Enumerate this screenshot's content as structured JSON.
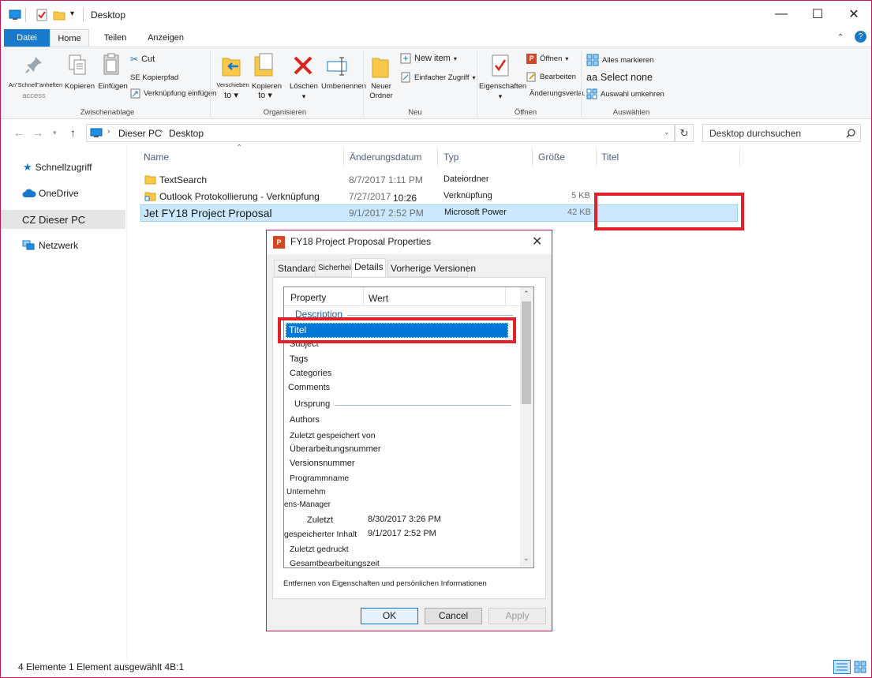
{
  "window": {
    "title": "Desktop"
  },
  "ribbon_tabs": {
    "datei": "Datei",
    "start": "Home",
    "teilen": "Teilen",
    "anzeigen": "Anzeigen"
  },
  "ribbon": {
    "clipboard": {
      "pin_label": "An\"Schnell\"anheften",
      "pin_sub": "access",
      "copy": "Kopieren",
      "paste": "Einfügen",
      "cut": "Cut",
      "copy_path": "SE Kopierpfad",
      "paste_shortcut": "Verknüpfung einfügen",
      "group": "Zwischenablage"
    },
    "organize": {
      "move": "Verschieben",
      "move_to": "to",
      "copy": "Kopieren",
      "copy_to": "to",
      "delete": "Löschen",
      "rename": "Umbenennen",
      "group": "Organisieren"
    },
    "new": {
      "new_folder_1": "Neuer",
      "new_folder_2": "Ordner",
      "new_item": "New item",
      "easy_access": "Einfacher Zugriff",
      "group": "Neu"
    },
    "open": {
      "properties": "Eigenschaften",
      "open": "Öffnen",
      "edit": "Bearbeiten",
      "history": "Änderungsverlauf",
      "group": "Öffnen"
    },
    "select": {
      "select_all": "Alles markieren",
      "select_none_prefix": "aa",
      "select_none": "Select none",
      "invert": "Auswahl umkehren",
      "group": "Auswählen"
    }
  },
  "address": {
    "path_1": "Dieser PC",
    "path_2": "Desktop",
    "search_placeholder": "Desktop durchsuchen"
  },
  "nav": {
    "quick": "Schnellzugriff",
    "onedrive": "OneDrive",
    "thispc": "CZ Dieser PC",
    "network": "Netzwerk"
  },
  "columns": {
    "name": "Name",
    "date": "Änderungsdatum",
    "type": "Typ",
    "size": "Größe",
    "title": "Titel"
  },
  "files": [
    {
      "name": "TextSearch",
      "date": "8/7/2017 1:11 PM",
      "type": "Dateiordner",
      "size": ""
    },
    {
      "name": "Outlook Protokollierung - Verknüpfung",
      "date": "7/27/2017",
      "time": "10:26",
      "type": "Verknüpfung",
      "size": "5 KB"
    },
    {
      "name": "Jet FY18 Project Proposal",
      "date": "9/1/2017 2:52 PM",
      "type": "Microsoft Power",
      "size": "42 KB"
    }
  ],
  "dialog": {
    "title": "FY18 Project Proposal Properties",
    "tabs": {
      "standard": "Standard",
      "sicherheit": "Sicherheit",
      "details": "Details",
      "versionen": "Vorherige Versionen"
    },
    "col_property": "Property",
    "col_value": "Wert",
    "section_description": "Description",
    "props_desc": {
      "titel": "Titel",
      "subject": "Subject",
      "tags": "Tags",
      "categories": "Categories",
      "comments": "Comments"
    },
    "section_origin": "Ursprung",
    "props_origin": {
      "authors": "Authors",
      "saved_by": "Zuletzt gespeichert von",
      "revision": "Überarbeitungsnummer",
      "version": "Versionsnummer",
      "program": "Programmname",
      "company_1": "Unternehm",
      "company_2": "ens-Manager",
      "last_1": "Zuletzt",
      "last_1_value": "8/30/2017 3:26 PM",
      "last_2": "gespeicherter Inhalt",
      "last_2_value": "9/1/2017 2:52 PM",
      "printed": "Zuletzt gedruckt",
      "total_edit": "Gesamtbearbeitungszeit"
    },
    "remove_link": "Entfernen von Eigenschaften und persönlichen Informationen",
    "ok": "OK",
    "cancel": "Cancel",
    "apply": "Apply"
  },
  "status": {
    "text": "4 Elemente 1 Element ausgewählt 4B:1"
  },
  "colors": {
    "accent": "#1979ca",
    "highlight_red": "#e0202b",
    "selection": "#cce8ff",
    "dialog_border": "#c2185b"
  }
}
